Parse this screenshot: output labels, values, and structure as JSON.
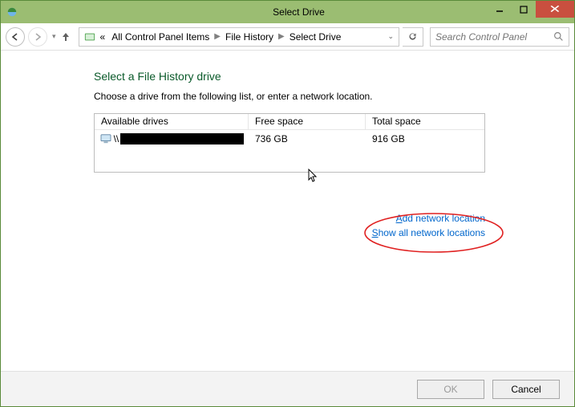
{
  "window": {
    "title": "Select Drive"
  },
  "breadcrumb": {
    "root_label": "All Control Panel Items",
    "mid_label": "File History",
    "leaf_label": "Select Drive",
    "leading": "«"
  },
  "search": {
    "placeholder": "Search Control Panel"
  },
  "page": {
    "heading": "Select a File History drive",
    "subtext": "Choose a drive from the following list, or enter a network location."
  },
  "table": {
    "columns": {
      "c1": "Available drives",
      "c2": "Free space",
      "c3": "Total space"
    },
    "rows": [
      {
        "path_prefix": "\\\\",
        "free": "736 GB",
        "total": "916 GB"
      }
    ]
  },
  "links": {
    "add": "dd network location",
    "add_accel": "A",
    "show": "how all network locations",
    "show_accel": "S"
  },
  "footer": {
    "ok": "OK",
    "cancel": "Cancel"
  }
}
